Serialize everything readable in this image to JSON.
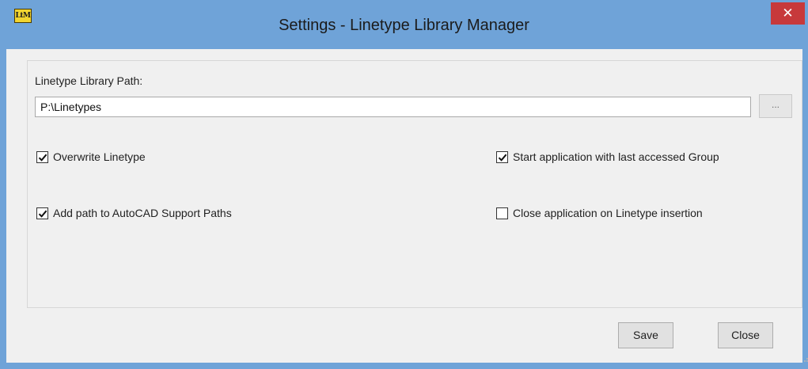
{
  "window": {
    "title": "Settings - Linetype Library Manager",
    "app_icon_text": "LtM",
    "close_glyph": "✕"
  },
  "library_path": {
    "label": "Linetype Library Path:",
    "value": "P:\\Linetypes",
    "browse_label": "..."
  },
  "options": [
    {
      "label": "Overwrite Linetype",
      "checked": true
    },
    {
      "label": "Add path to AutoCAD Support Paths",
      "checked": true
    },
    {
      "label": "Start application with last accessed Group",
      "checked": true
    },
    {
      "label": "Close application on Linetype insertion",
      "checked": false
    }
  ],
  "buttons": {
    "save": "Save",
    "close": "Close"
  },
  "colors": {
    "titlebar": "#6fa3d8",
    "close_button": "#c7393b",
    "client": "#f0f0f0"
  }
}
